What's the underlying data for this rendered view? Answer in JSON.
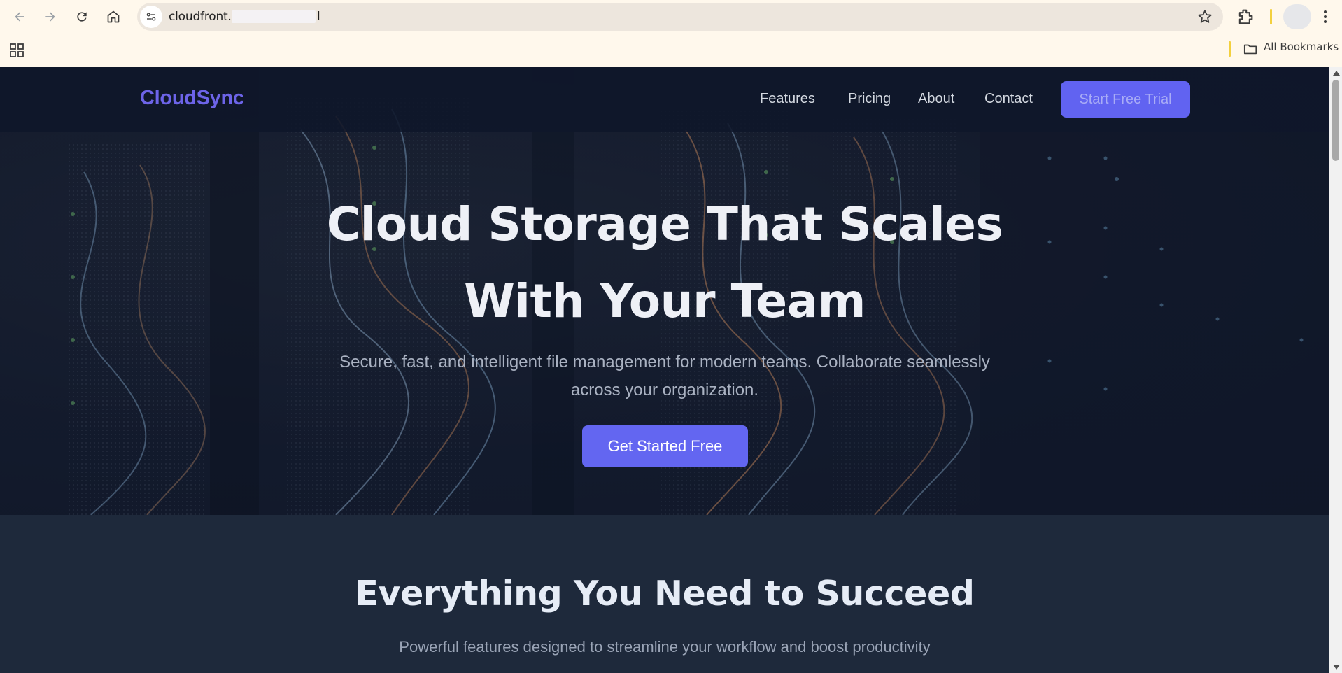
{
  "browser": {
    "url": "cloudfront.",
    "url_tail": "l",
    "bookmarks_label": "All Bookmarks"
  },
  "site": {
    "logo": "CloudSync",
    "nav": [
      "Features",
      "Pricing",
      "About",
      "Contact"
    ],
    "cta_trial": "Start Free Trial"
  },
  "hero": {
    "title_line1": "Cloud Storage That Scales",
    "title_line2": "With Your Team",
    "subtitle_line1": "Secure, fast, and intelligent file management for modern teams. Collaborate seamlessly",
    "subtitle_line2": "across your organization.",
    "primary_cta": "Get Started Free"
  },
  "features": {
    "title": "Everything You Need to Succeed",
    "subtitle": "Powerful features designed to streamline your workflow and boost productivity"
  },
  "colors": {
    "brand": "#6366f1",
    "nav_bg": "#0f172a",
    "section_bg": "#1e293b",
    "chrome_bg": "#fff8ec"
  },
  "icons": [
    "back-arrow-icon",
    "forward-arrow-icon",
    "reload-icon",
    "home-icon",
    "site-info-icon",
    "star-icon",
    "extensions-icon",
    "kebab-menu-icon",
    "apps-grid-icon",
    "folder-icon"
  ]
}
